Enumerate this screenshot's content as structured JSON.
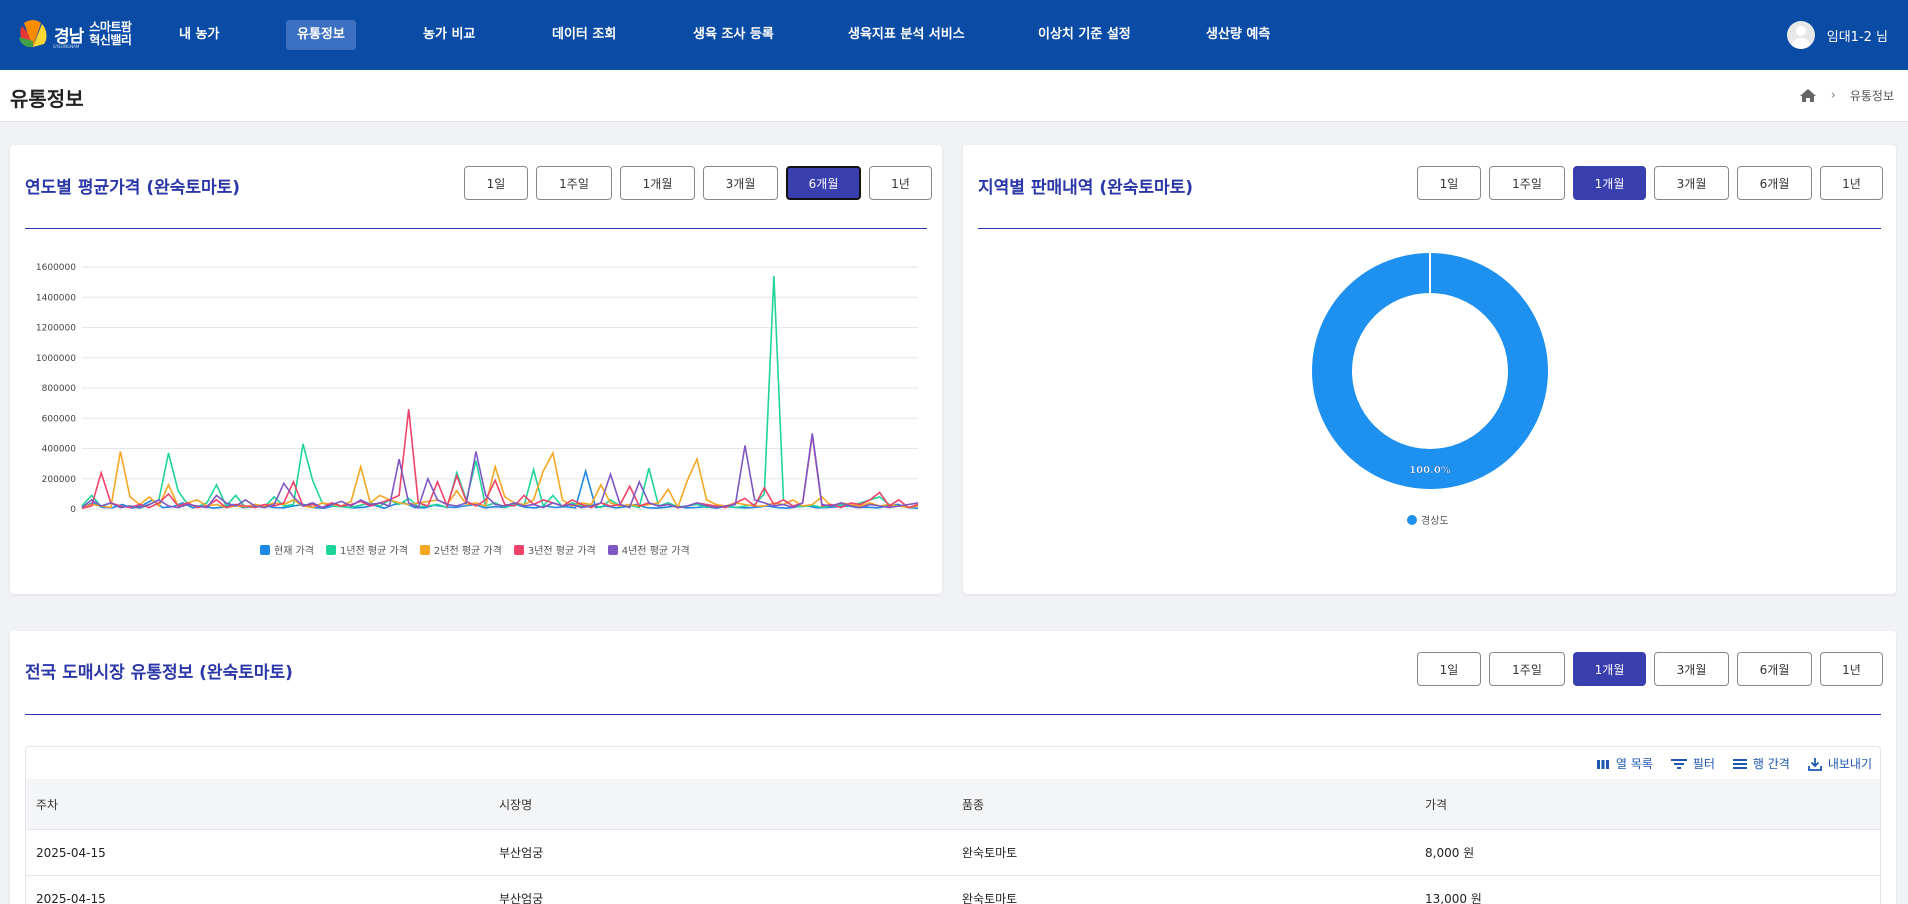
{
  "brand": {
    "name_a": "경남",
    "name_b_line1": "스마트팜",
    "name_b_line2": "혁신밸리",
    "sub": "GYEONGNAM"
  },
  "nav": {
    "items": [
      {
        "label": "내 농가"
      },
      {
        "label": "유통정보"
      },
      {
        "label": "농가 비교"
      },
      {
        "label": "데이터 조회"
      },
      {
        "label": "생육 조사 등록"
      },
      {
        "label": "생육지표 분석 서비스"
      },
      {
        "label": "이상치 기준 설정"
      },
      {
        "label": "생산량 예측"
      }
    ],
    "active_index": 1
  },
  "user": {
    "name": "임대1-2 님"
  },
  "page": {
    "title": "유통정보"
  },
  "breadcrumb": {
    "current": "유통정보"
  },
  "periods": [
    "1일",
    "1주일",
    "1개월",
    "3개월",
    "6개월",
    "1년"
  ],
  "price_card": {
    "title": "연도별 평균가격 (완숙토마토)",
    "active_period": "6개월"
  },
  "region_card": {
    "title": "지역별 판매내역 (완숙토마토)",
    "active_period": "1개월"
  },
  "market_card": {
    "title": "전국 도매시장 유통정보 (완숙토마토)",
    "active_period": "1개월",
    "toolbar": [
      "열 목록",
      "필터",
      "행 간격",
      "내보내기"
    ],
    "columns": [
      "주차",
      "시장명",
      "품종",
      "가격"
    ],
    "rows": [
      [
        "2025-04-15",
        "부산엄궁",
        "완숙토마토",
        "8,000 원"
      ],
      [
        "2025-04-15",
        "부산엄궁",
        "완숙토마토",
        "13,000 원"
      ]
    ]
  },
  "chart_data": [
    {
      "type": "line",
      "ylim": [
        0,
        1600000
      ],
      "yticks": [
        0,
        200000,
        400000,
        600000,
        800000,
        1000000,
        1200000,
        1400000,
        1600000
      ],
      "grid": true,
      "legend_position": "bottom",
      "series": [
        {
          "name": "현재 가격",
          "color": "#1e88e5",
          "values": [
            5000,
            40000,
            12000,
            8000,
            30000,
            5000,
            25000,
            60000,
            10000,
            15000,
            40000,
            8000,
            20000,
            6000,
            12000,
            30000,
            9000,
            15000,
            25000,
            10000,
            8000,
            20000,
            30000,
            10000,
            5000,
            20000,
            15000,
            8000,
            12000,
            25000,
            5000,
            30000,
            40000,
            10000,
            8000,
            25000,
            15000,
            10000,
            20000,
            30000,
            8000,
            15000,
            10000,
            30000,
            12000,
            8000,
            20000,
            10000,
            15000,
            8000,
            250000,
            10000,
            20000,
            8000,
            15000,
            30000,
            10000,
            5000,
            12000,
            20000,
            8000,
            10000,
            15000,
            5000,
            20000,
            10000,
            8000,
            12000,
            20000,
            10000,
            5000,
            15000,
            20000,
            8000,
            10000,
            15000,
            20000,
            10000,
            12000,
            8000,
            20000,
            30000,
            10000,
            5000
          ]
        },
        {
          "name": "1년전 평균 가격",
          "color": "#1ed49a",
          "values": [
            20000,
            90000,
            15000,
            40000,
            10000,
            20000,
            5000,
            30000,
            60000,
            370000,
            120000,
            30000,
            15000,
            40000,
            160000,
            20000,
            90000,
            10000,
            30000,
            15000,
            80000,
            20000,
            30000,
            430000,
            190000,
            40000,
            20000,
            15000,
            10000,
            25000,
            40000,
            20000,
            60000,
            30000,
            70000,
            15000,
            20000,
            30000,
            10000,
            240000,
            60000,
            320000,
            20000,
            40000,
            10000,
            30000,
            20000,
            260000,
            20000,
            90000,
            15000,
            40000,
            20000,
            30000,
            10000,
            60000,
            20000,
            25000,
            10000,
            270000,
            20000,
            40000,
            15000,
            20000,
            30000,
            10000,
            20000,
            15000,
            10000,
            20000,
            30000,
            100000,
            1540000,
            60000,
            20000,
            15000,
            25000,
            10000,
            20000,
            30000,
            20000,
            40000,
            60000,
            80000,
            30000,
            20000,
            10000,
            20000
          ]
        },
        {
          "name": "2년전 평균 가격",
          "color": "#f5a623",
          "values": [
            10000,
            30000,
            20000,
            10000,
            380000,
            80000,
            30000,
            80000,
            20000,
            160000,
            20000,
            40000,
            60000,
            20000,
            30000,
            10000,
            20000,
            15000,
            30000,
            20000,
            40000,
            30000,
            60000,
            20000,
            10000,
            40000,
            30000,
            20000,
            50000,
            280000,
            40000,
            90000,
            60000,
            40000,
            30000,
            40000,
            50000,
            60000,
            30000,
            120000,
            30000,
            40000,
            20000,
            280000,
            80000,
            40000,
            30000,
            60000,
            250000,
            370000,
            60000,
            20000,
            40000,
            30000,
            160000,
            40000,
            20000,
            30000,
            20000,
            30000,
            40000,
            130000,
            10000,
            190000,
            330000,
            60000,
            30000,
            20000,
            40000,
            30000,
            20000,
            20000,
            40000,
            30000,
            60000,
            20000,
            30000,
            80000,
            20000,
            40000,
            30000,
            20000,
            40000,
            20000,
            30000,
            20000,
            10000,
            20000
          ]
        },
        {
          "name": "3년전 평균 가격",
          "color": "#f0436a",
          "values": [
            5000,
            20000,
            240000,
            40000,
            20000,
            10000,
            30000,
            10000,
            40000,
            100000,
            20000,
            40000,
            10000,
            20000,
            60000,
            10000,
            30000,
            20000,
            10000,
            30000,
            20000,
            40000,
            180000,
            20000,
            30000,
            10000,
            40000,
            20000,
            30000,
            50000,
            20000,
            40000,
            60000,
            90000,
            660000,
            40000,
            20000,
            180000,
            20000,
            220000,
            50000,
            20000,
            60000,
            190000,
            30000,
            20000,
            90000,
            30000,
            60000,
            40000,
            20000,
            60000,
            30000,
            10000,
            40000,
            20000,
            30000,
            150000,
            20000,
            40000,
            20000,
            30000,
            10000,
            20000,
            40000,
            30000,
            20000,
            10000,
            40000,
            70000,
            20000,
            140000,
            30000,
            60000,
            20000,
            40000,
            490000,
            20000,
            30000,
            10000,
            40000,
            30000,
            60000,
            110000,
            20000,
            60000,
            10000,
            30000
          ]
        },
        {
          "name": "4년전 평균 가격",
          "color": "#7e57c2",
          "values": [
            10000,
            60000,
            20000,
            40000,
            10000,
            20000,
            10000,
            30000,
            60000,
            20000,
            10000,
            30000,
            20000,
            10000,
            90000,
            40000,
            20000,
            60000,
            20000,
            10000,
            30000,
            170000,
            80000,
            20000,
            40000,
            10000,
            30000,
            50000,
            20000,
            60000,
            30000,
            40000,
            20000,
            330000,
            40000,
            10000,
            200000,
            60000,
            30000,
            20000,
            40000,
            380000,
            90000,
            30000,
            20000,
            40000,
            20000,
            30000,
            10000,
            40000,
            20000,
            30000,
            10000,
            20000,
            40000,
            230000,
            30000,
            10000,
            180000,
            40000,
            20000,
            30000,
            10000,
            20000,
            40000,
            20000,
            10000,
            20000,
            30000,
            420000,
            60000,
            40000,
            20000,
            30000,
            10000,
            40000,
            500000,
            30000,
            20000,
            40000,
            20000,
            10000,
            30000,
            20000,
            10000,
            20000,
            30000,
            40000
          ]
        }
      ]
    },
    {
      "type": "pie",
      "donut": true,
      "slices": [
        {
          "label": "경상도",
          "value": 100.0,
          "display": "100.0%",
          "color": "#1e90f0"
        }
      ],
      "legend_position": "bottom"
    }
  ]
}
